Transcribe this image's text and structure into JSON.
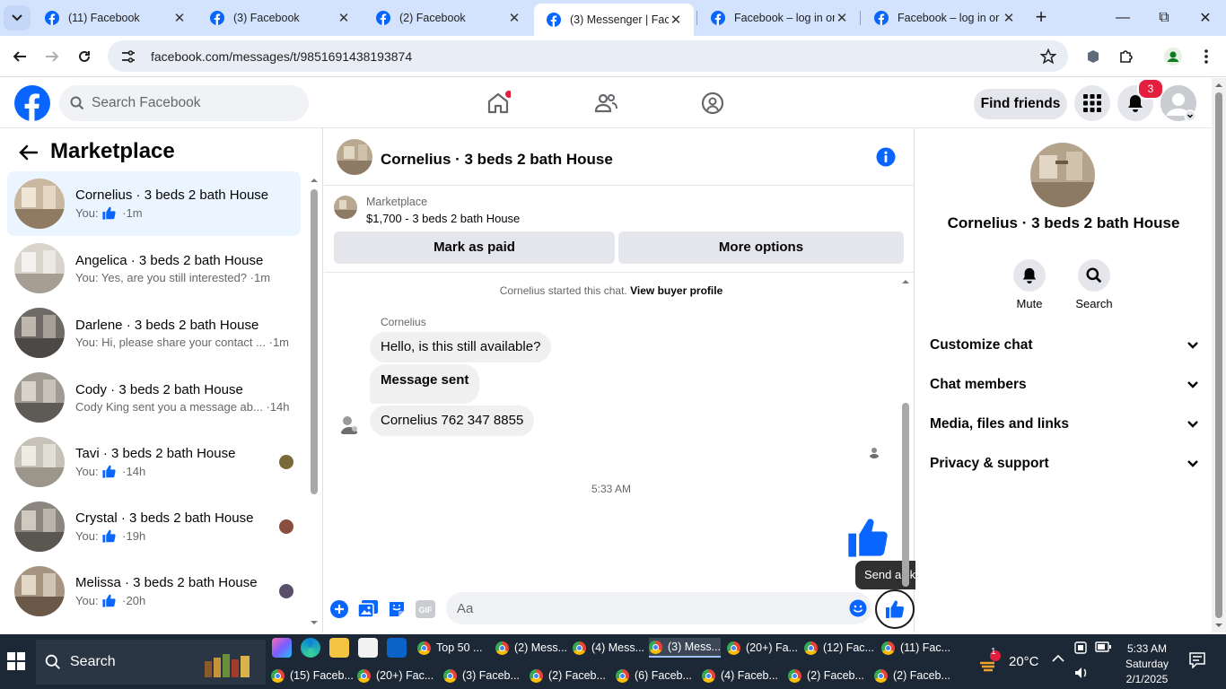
{
  "browser": {
    "tabs": [
      {
        "title": "(11) Facebook",
        "active": false
      },
      {
        "title": "(3) Facebook",
        "active": false
      },
      {
        "title": "(2) Facebook",
        "active": false
      },
      {
        "title": "(3) Messenger | Facebook",
        "active": true
      },
      {
        "title": "Facebook – log in or sign up",
        "active": false
      },
      {
        "title": "Facebook – log in or sign up",
        "active": false
      }
    ],
    "url": "facebook.com/messages/t/9851691438193874"
  },
  "fb_header": {
    "search_placeholder": "Search Facebook",
    "find_friends": "Find friends",
    "notification_count": "3"
  },
  "left_panel": {
    "title": "Marketplace",
    "conversations": [
      {
        "name": "Cornelius · 3 beds 2 bath House",
        "prefix": "You:",
        "preview": "",
        "like": true,
        "time": "1m",
        "selected": true
      },
      {
        "name": "Angelica · 3 beds 2 bath House",
        "prefix": "You: Yes, are you still interested?",
        "preview": "",
        "like": false,
        "time": "1m",
        "selected": false
      },
      {
        "name": "Darlene · 3 beds 2 bath House",
        "prefix": "You: Hi, please share your contact ...",
        "preview": "",
        "like": false,
        "time": "1m",
        "selected": false
      },
      {
        "name": "Cody · 3 beds 2 bath House",
        "prefix": "Cody King sent you a message ab...",
        "preview": "",
        "like": false,
        "time": "14h",
        "selected": false
      },
      {
        "name": "Tavi · 3 beds 2 bath House",
        "prefix": "You:",
        "preview": "",
        "like": true,
        "time": "14h",
        "selected": false
      },
      {
        "name": "Crystal · 3 beds 2 bath House",
        "prefix": "You:",
        "preview": "",
        "like": true,
        "time": "19h",
        "selected": false
      },
      {
        "name": "Melissa · 3 beds 2 bath House",
        "prefix": "You:",
        "preview": "",
        "like": true,
        "time": "20h",
        "selected": false
      }
    ]
  },
  "chat": {
    "title": "Cornelius · 3 beds 2 bath House",
    "marketplace_label": "Marketplace",
    "listing": "$1,700 - 3 beds 2 bath House",
    "mark_paid": "Mark as paid",
    "more_options": "More options",
    "started_text": "Cornelius started this chat.",
    "view_profile": "View buyer profile",
    "sender": "Cornelius",
    "messages": [
      {
        "text": "Hello, is this still available?",
        "bold": false
      },
      {
        "text": "Message sent",
        "bold": true
      },
      {
        "text": "Cornelius 762 347 8855",
        "bold": false
      }
    ],
    "timestamp": "5:33 AM",
    "tooltip": "Send a like",
    "input_placeholder": "Aa"
  },
  "right_panel": {
    "name": "Cornelius · 3 beds 2 bath House",
    "mute": "Mute",
    "search": "Search",
    "sections": [
      "Customize chat",
      "Chat members",
      "Media, files and links",
      "Privacy & support"
    ]
  },
  "taskbar": {
    "search": "Search",
    "row1": [
      {
        "label": "Top 50 ...",
        "active": false
      },
      {
        "label": "(2) Mess...",
        "active": false
      },
      {
        "label": "(4) Mess...",
        "active": false
      },
      {
        "label": "(3) Mess...",
        "active": true
      },
      {
        "label": "(20+) Fa...",
        "active": false
      },
      {
        "label": "(12) Fac...",
        "active": false
      },
      {
        "label": "(11) Fac...",
        "active": false
      }
    ],
    "row2": [
      {
        "label": "(15) Faceb..."
      },
      {
        "label": "(20+) Fac..."
      },
      {
        "label": "(3) Faceb..."
      },
      {
        "label": "(2) Faceb..."
      },
      {
        "label": "(6) Faceb..."
      },
      {
        "label": "(4) Faceb..."
      },
      {
        "label": "(2) Faceb..."
      },
      {
        "label": "(2) Faceb..."
      }
    ],
    "weather_badge": "1",
    "temperature": "20°C",
    "time": "5:33 AM",
    "day": "Saturday",
    "date": "2/1/2025"
  },
  "colors": {
    "fb_blue": "#0866ff",
    "selected_row": "#ebf5ff",
    "tab_strip": "#d3e3fd"
  }
}
